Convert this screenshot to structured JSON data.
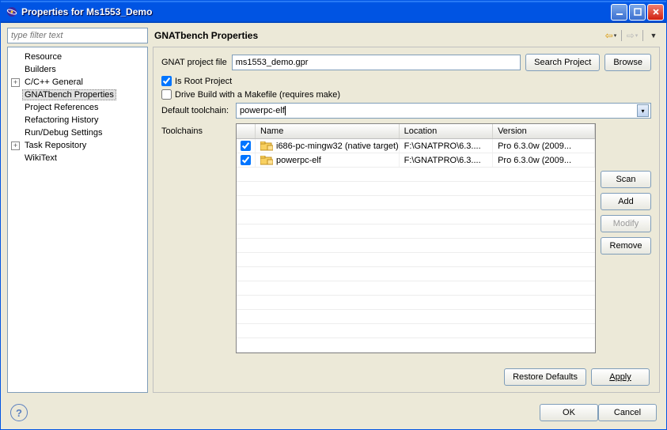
{
  "window": {
    "title": "Properties for Ms1553_Demo"
  },
  "filter": {
    "placeholder": "type filter text"
  },
  "tree": {
    "items": [
      {
        "label": "Resource",
        "expandable": false,
        "indent": 1
      },
      {
        "label": "Builders",
        "expandable": false,
        "indent": 1
      },
      {
        "label": "C/C++ General",
        "expandable": true,
        "indent": 0
      },
      {
        "label": "GNATbench Properties",
        "expandable": false,
        "indent": 1,
        "selected": true
      },
      {
        "label": "Project References",
        "expandable": false,
        "indent": 1
      },
      {
        "label": "Refactoring History",
        "expandable": false,
        "indent": 1
      },
      {
        "label": "Run/Debug Settings",
        "expandable": false,
        "indent": 1
      },
      {
        "label": "Task Repository",
        "expandable": true,
        "indent": 0
      },
      {
        "label": "WikiText",
        "expandable": false,
        "indent": 1
      }
    ]
  },
  "panel": {
    "title": "GNATbench Properties",
    "project_file_label": "GNAT project file",
    "project_file_value": "ms1553_demo.gpr",
    "search_project_btn": "Search Project",
    "browse_btn": "Browse",
    "root_project_label": "Is Root Project",
    "root_project_checked": true,
    "drive_build_label": "Drive Build with a Makefile (requires make)",
    "drive_build_checked": false,
    "default_toolchain_label": "Default toolchain:",
    "default_toolchain_value": "powerpc-elf",
    "toolchains_label": "Toolchains",
    "columns": {
      "name": "Name",
      "location": "Location",
      "version": "Version"
    },
    "rows": [
      {
        "checked": true,
        "name": "i686-pc-mingw32 (native target)",
        "location": "F:\\GNATPRO\\6.3....",
        "version": "Pro 6.3.0w (2009..."
      },
      {
        "checked": true,
        "name": "powerpc-elf",
        "location": "F:\\GNATPRO\\6.3....",
        "version": "Pro 6.3.0w (2009..."
      }
    ],
    "btns": {
      "scan": "Scan",
      "add": "Add",
      "modify": "Modify",
      "remove": "Remove"
    },
    "footer": {
      "restore": "Restore Defaults",
      "apply": "Apply"
    }
  },
  "dialog": {
    "ok": "OK",
    "cancel": "Cancel"
  }
}
